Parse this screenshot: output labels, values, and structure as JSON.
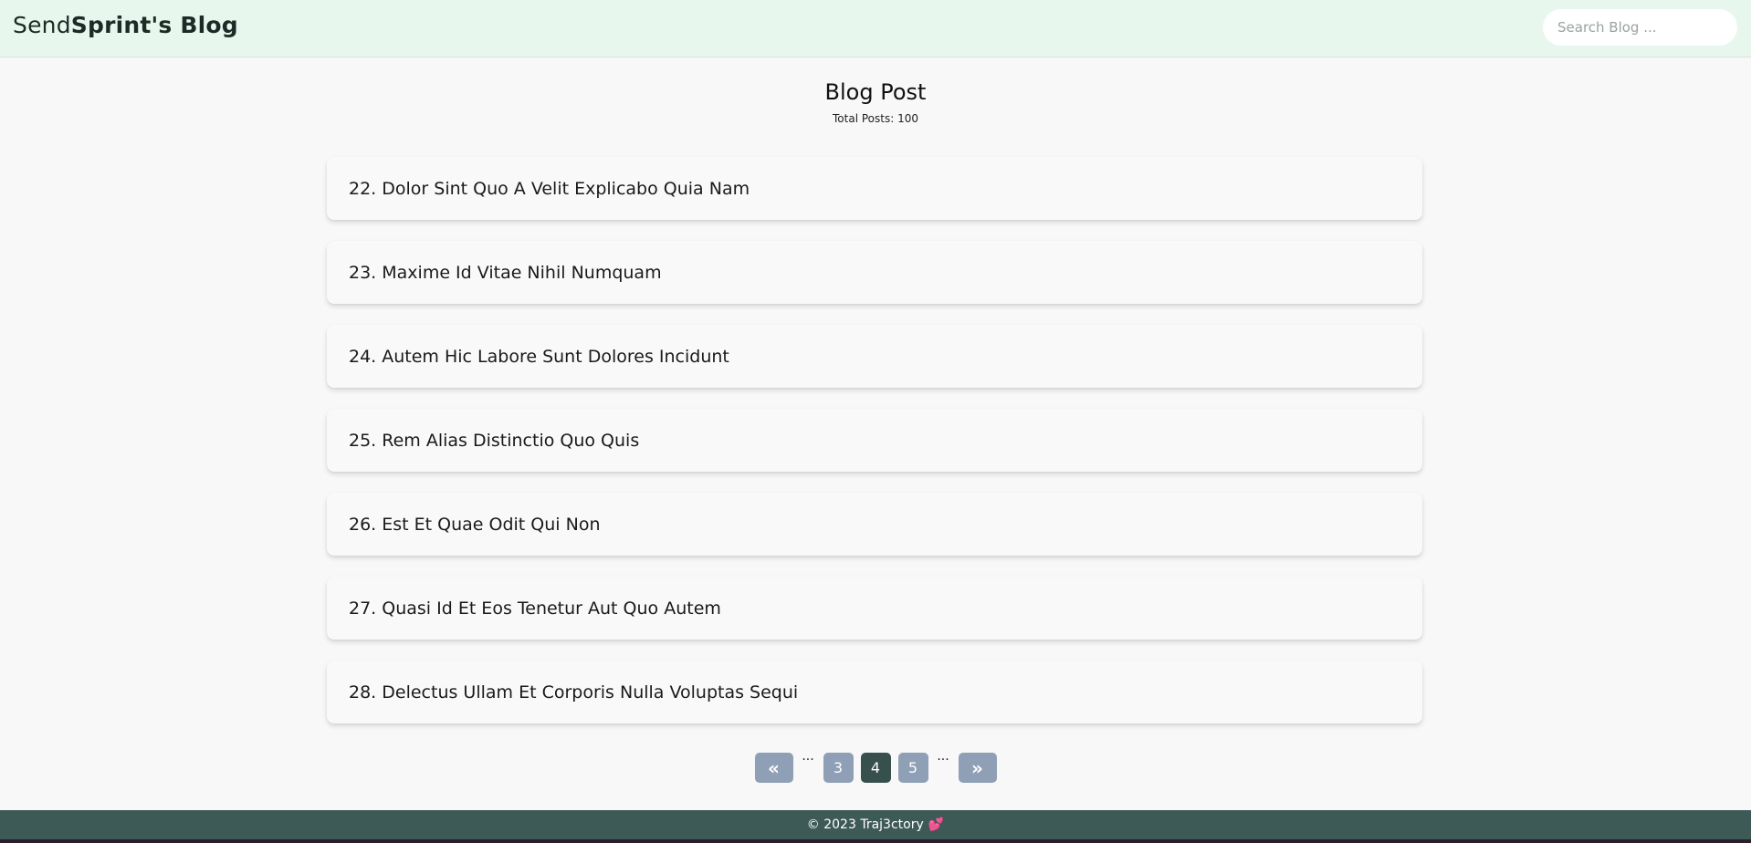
{
  "header": {
    "brand_send": "Send",
    "brand_sprint": "Sprint",
    "brand_rest": "'s Blog",
    "search_placeholder": "Search Blog ..."
  },
  "main": {
    "title": "Blog Post",
    "total_posts": "Total Posts: 100",
    "posts": [
      {
        "label": "22. Dolor Sint Quo A Velit Explicabo Quia Nam"
      },
      {
        "label": "23. Maxime Id Vitae Nihil Numquam"
      },
      {
        "label": "24. Autem Hic Labore Sunt Dolores Incidunt"
      },
      {
        "label": "25. Rem Alias Distinctio Quo Quis"
      },
      {
        "label": "26. Est Et Quae Odit Qui Non"
      },
      {
        "label": "27. Quasi Id Et Eos Tenetur Aut Quo Autem"
      },
      {
        "label": "28. Delectus Ullam Et Corporis Nulla Voluptas Sequi"
      }
    ]
  },
  "pagination": {
    "prev_icon": "«",
    "next_icon": "»",
    "ellipsis": "...",
    "pages": [
      "3",
      "4",
      "5"
    ],
    "current": "4",
    "button_color": "#8f9fb6",
    "active_color": "#374f4d"
  },
  "footer": {
    "text": "© 2023 Traj3ctory",
    "heart_icon": "heart-icon"
  },
  "colors": {
    "header_bg": "#e8f7ee",
    "footer_bg": "#3e5a57",
    "page_bg": "#f8f8f8"
  }
}
